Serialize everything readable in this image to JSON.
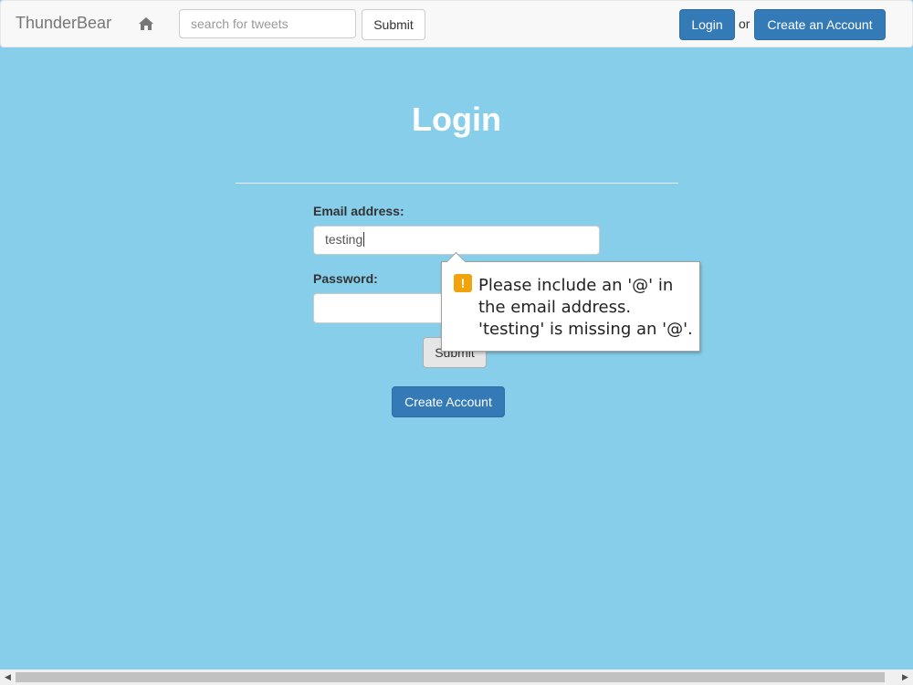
{
  "navbar": {
    "brand": "ThunderBear",
    "home_icon": "home-icon",
    "search": {
      "placeholder": "search for tweets",
      "value": ""
    },
    "search_submit": "Submit",
    "login": "Login",
    "or": "or",
    "create_account": "Create an Account"
  },
  "main": {
    "title": "Login",
    "email_label": "Email address:",
    "email_value": "testing",
    "password_label": "Password:",
    "password_value": "",
    "submit": "Submit",
    "create_account": "Create Account"
  },
  "validation": {
    "icon": "warning-icon",
    "message": "Please include an '@' in the email address. 'testing' is missing an '@'."
  },
  "colors": {
    "background": "#87ceeb",
    "primary": "#337ab7",
    "warning": "#f0a30a"
  }
}
